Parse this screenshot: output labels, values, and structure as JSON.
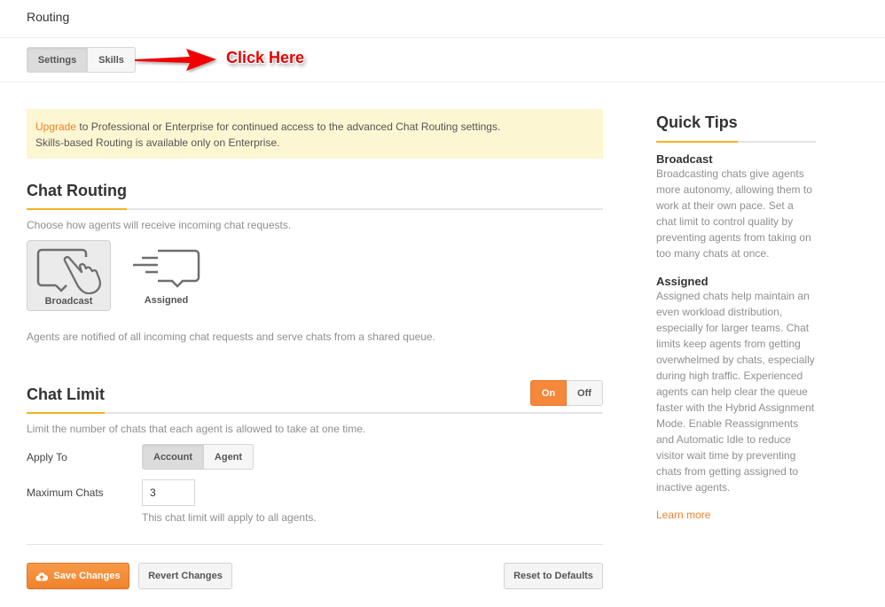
{
  "header": {
    "title": "Routing"
  },
  "tabs": [
    {
      "label": "Settings",
      "active": true
    },
    {
      "label": "Skills",
      "active": false
    }
  ],
  "annotation": {
    "text": "Click Here",
    "color": "#e80000"
  },
  "notice": {
    "link": "Upgrade",
    "line1_rest": " to Professional or Enterprise for continued access to the advanced Chat Routing settings.",
    "line2": "Skills-based Routing is available only on Enterprise."
  },
  "chat_routing": {
    "title": "Chat Routing",
    "description": "Choose how agents will receive incoming chat requests.",
    "options": [
      {
        "label": "Broadcast",
        "icon": "hand-chat-bubble-icon",
        "selected": true
      },
      {
        "label": "Assigned",
        "icon": "speed-chat-bubble-icon",
        "selected": false
      }
    ],
    "selected_description": "Agents are notified of all incoming chat requests and serve chats from a shared queue."
  },
  "chat_limit": {
    "title": "Chat Limit",
    "toggle": {
      "on_label": "On",
      "off_label": "Off",
      "value": "On"
    },
    "description": "Limit the number of chats that each agent is allowed to take at one time.",
    "apply_to": {
      "label": "Apply To",
      "options": [
        "Account",
        "Agent"
      ],
      "selected": "Account"
    },
    "max_chats": {
      "label": "Maximum Chats",
      "value": "3",
      "help": "This chat limit will apply to all agents."
    }
  },
  "actions": {
    "save": "Save Changes",
    "revert": "Revert Changes",
    "reset": "Reset to Defaults"
  },
  "quick_tips": {
    "title": "Quick Tips",
    "tips": [
      {
        "heading": "Broadcast",
        "body": "Broadcasting chats give agents more autonomy, allowing them to work at their own pace. Set a chat limit to control quality by preventing agents from taking on too many chats at once."
      },
      {
        "heading": "Assigned",
        "body": "Assigned chats help maintain an even workload distribution, especially for larger teams. Chat limits keep agents from getting overwhelmed by chats, especially during high traffic. Experienced agents can help clear the queue faster with the Hybrid Assignment Mode. Enable Reassignments and Automatic Idle to reduce visitor wait time by preventing chats from getting assigned to inactive agents."
      }
    ],
    "learn_more": "Learn more"
  },
  "colors": {
    "accent_orange": "#f0822c",
    "underline_gold": "#f0b323",
    "notice_bg": "#fcf6d2"
  }
}
